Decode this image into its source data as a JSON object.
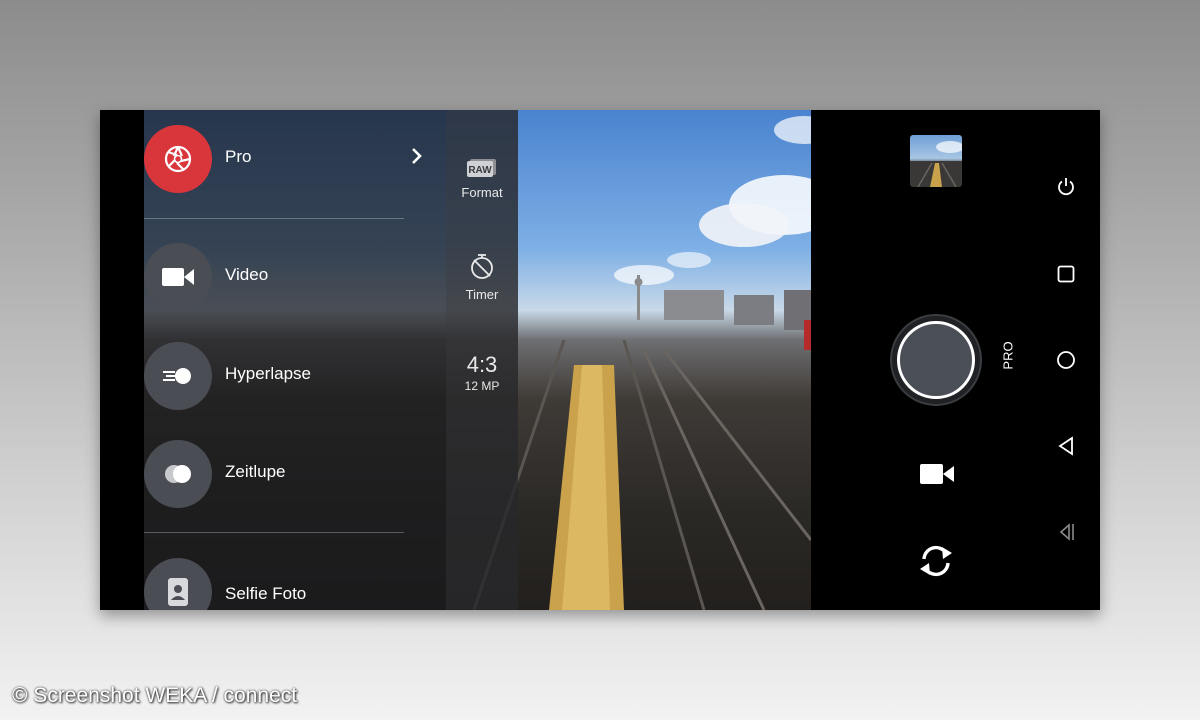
{
  "modes": [
    {
      "label": "Pro",
      "icon": "aperture-icon",
      "active": true
    },
    {
      "label": "Video",
      "icon": "video-camera-icon"
    },
    {
      "label": "Hyperlapse",
      "icon": "hyperlapse-icon"
    },
    {
      "label": "Zeitlupe",
      "icon": "slow-motion-icon"
    },
    {
      "label": "Selfie Foto",
      "icon": "selfie-icon"
    }
  ],
  "settings": {
    "format": {
      "badge": "RAW",
      "label": "Format"
    },
    "timer": {
      "label": "Timer",
      "icon": "timer-icon"
    },
    "ratio": {
      "value": "4:3",
      "resolution": "12 MP"
    }
  },
  "controls": {
    "shutter_mode": "PRO",
    "video_icon": "video-camera-icon",
    "switch_icon": "switch-camera-icon",
    "thumbnail": "gallery-thumbnail"
  },
  "nav": [
    "power-icon",
    "square-icon",
    "home-circle-icon",
    "back-triangle-icon",
    "collapse-bar-icon"
  ],
  "colors": {
    "accent": "#d9363c",
    "mode_circle": "#4a4d54"
  },
  "watermark": "© Screenshot WEKA / connect"
}
